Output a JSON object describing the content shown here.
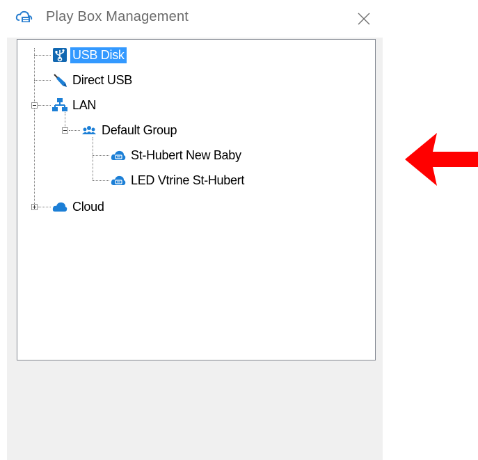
{
  "window": {
    "title": "Play Box Management"
  },
  "tree": {
    "nodes": [
      {
        "label": "USB Disk",
        "icon": "usb-icon",
        "selected": true
      },
      {
        "label": "Direct USB",
        "icon": "usb-cable-icon"
      },
      {
        "label": "LAN",
        "icon": "network-icon",
        "expanded": true
      },
      {
        "label": "Default Group",
        "icon": "group-icon",
        "expanded": true
      },
      {
        "label": "St-Hubert New Baby",
        "icon": "player-cloud-icon"
      },
      {
        "label": "LED Vtrine St-Hubert",
        "icon": "player-cloud-icon"
      },
      {
        "label": "Cloud",
        "icon": "cloud-icon",
        "expanded": false
      }
    ]
  },
  "colors": {
    "selection": "#3399ff",
    "icon_blue": "#1c7fd6",
    "arrow": "#ff0000"
  }
}
